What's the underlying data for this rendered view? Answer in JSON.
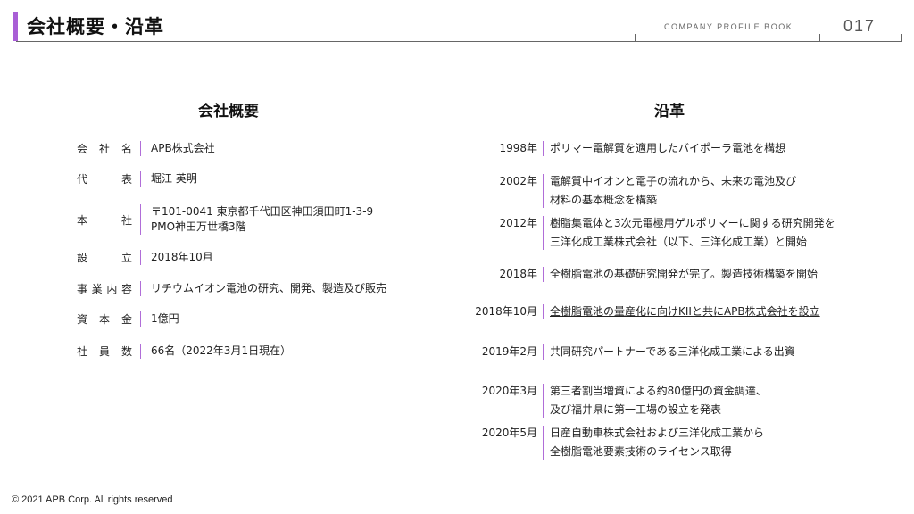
{
  "header": {
    "title": "会社概要・沿革",
    "book_label": "COMPANY PROFILE BOOK",
    "page_number": "017",
    "accent_color": "#a95fd6"
  },
  "profile": {
    "heading": "会社概要",
    "rows": [
      {
        "label": [
          "会",
          "社",
          "名"
        ],
        "value": [
          "APB株式会社"
        ]
      },
      {
        "label": [
          "代",
          "表"
        ],
        "value": [
          "堀江 英明"
        ]
      },
      {
        "label": [
          "本",
          "社"
        ],
        "value": [
          "〒101-0041 東京都千代田区神田須田町1-3-9",
          "PMO神田万世橋3階"
        ]
      },
      {
        "label": [
          "設",
          "立"
        ],
        "value": [
          "2018年10月"
        ]
      },
      {
        "label": [
          "事",
          "業",
          "内",
          "容"
        ],
        "value": [
          "リチウムイオン電池の研究、開発、製造及び販売"
        ]
      },
      {
        "label": [
          "資",
          "本",
          "金"
        ],
        "value": [
          "1億円"
        ]
      },
      {
        "label": [
          "社",
          "員",
          "数"
        ],
        "value": [
          "66名（2022年3月1日現在）"
        ]
      }
    ]
  },
  "history": {
    "heading": "沿革",
    "rows": [
      {
        "date": "1998年",
        "lines": [
          "ポリマー電解質を適用したバイポーラ電池を構想"
        ]
      },
      {
        "date": "2002年",
        "lines": [
          "電解質中イオンと電子の流れから、未来の電池及び",
          "材料の基本概念を構築"
        ]
      },
      {
        "date": "2012年",
        "lines": [
          "樹脂集電体と3次元電極用ゲルポリマーに関する研究開発を",
          "三洋化成工業株式会社（以下、三洋化成工業）と開始"
        ]
      },
      {
        "date": "2018年",
        "lines": [
          "全樹脂電池の基礎研究開発が完了。製造技術構築を開始"
        ]
      },
      {
        "date": "2018年10月",
        "lines": [
          "全樹脂電池の量産化に向けKIIと共にAPB株式会社を設立"
        ],
        "underline": true
      },
      {
        "date": "2019年2月",
        "lines": [
          "共同研究パートナーである三洋化成工業による出資"
        ]
      },
      {
        "date": "2020年3月",
        "lines": [
          "第三者割当増資による約80億円の資金調達、",
          "及び福井県に第一工場の設立を発表"
        ]
      },
      {
        "date": "2020年5月",
        "lines": [
          "日産自動車株式会社および三洋化成工業から",
          "全樹脂電池要素技術のライセンス取得"
        ]
      }
    ]
  },
  "footer": {
    "copyright": "© 2021 APB Corp. All rights reserved"
  }
}
